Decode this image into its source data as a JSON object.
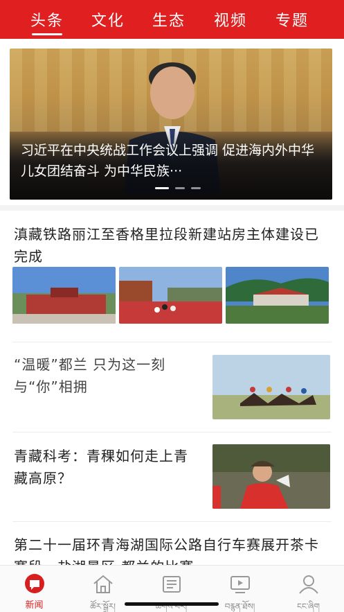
{
  "topnav": {
    "tabs": [
      "头条",
      "文化",
      "生态",
      "视频",
      "专题"
    ],
    "active": "头条"
  },
  "hero": {
    "caption": "习近平在中央统战工作会议上强调 促进海内外中华儿女团结奋斗 为中华民族···",
    "slides_total": 3,
    "slide_active": 1
  },
  "articles": [
    {
      "title": "滇藏铁路丽江至香格里拉段新建站房主体建设已完成",
      "layout": "three-images"
    },
    {
      "title": "“温暖”都兰 只为这一刻与“你”相拥",
      "layout": "right-image"
    },
    {
      "title": "青藏科考：青稞如何走上青藏高原？",
      "layout": "right-image"
    },
    {
      "title": "第二十一届环青海湖国际公路自行车赛展开茶卡赛段，盐湖景区-都兰的比赛",
      "layout": "text"
    }
  ],
  "bottom_nav": [
    {
      "label": "新闻",
      "icon": "news-icon",
      "active": true
    },
    {
      "label": "ཚོར་སྒྲོར།",
      "icon": "home-icon",
      "active": false
    },
    {
      "label": "ཚགས་པར།",
      "icon": "newspaper-icon",
      "active": false
    },
    {
      "label": "བརྙན་ཐོས།",
      "icon": "video-icon",
      "active": false
    },
    {
      "label": "ངང་ཞིག",
      "icon": "profile-icon",
      "active": false
    }
  ],
  "colors": {
    "brand_red": "#e02020",
    "active_label": "#d81e1e",
    "inactive": "#888888"
  }
}
